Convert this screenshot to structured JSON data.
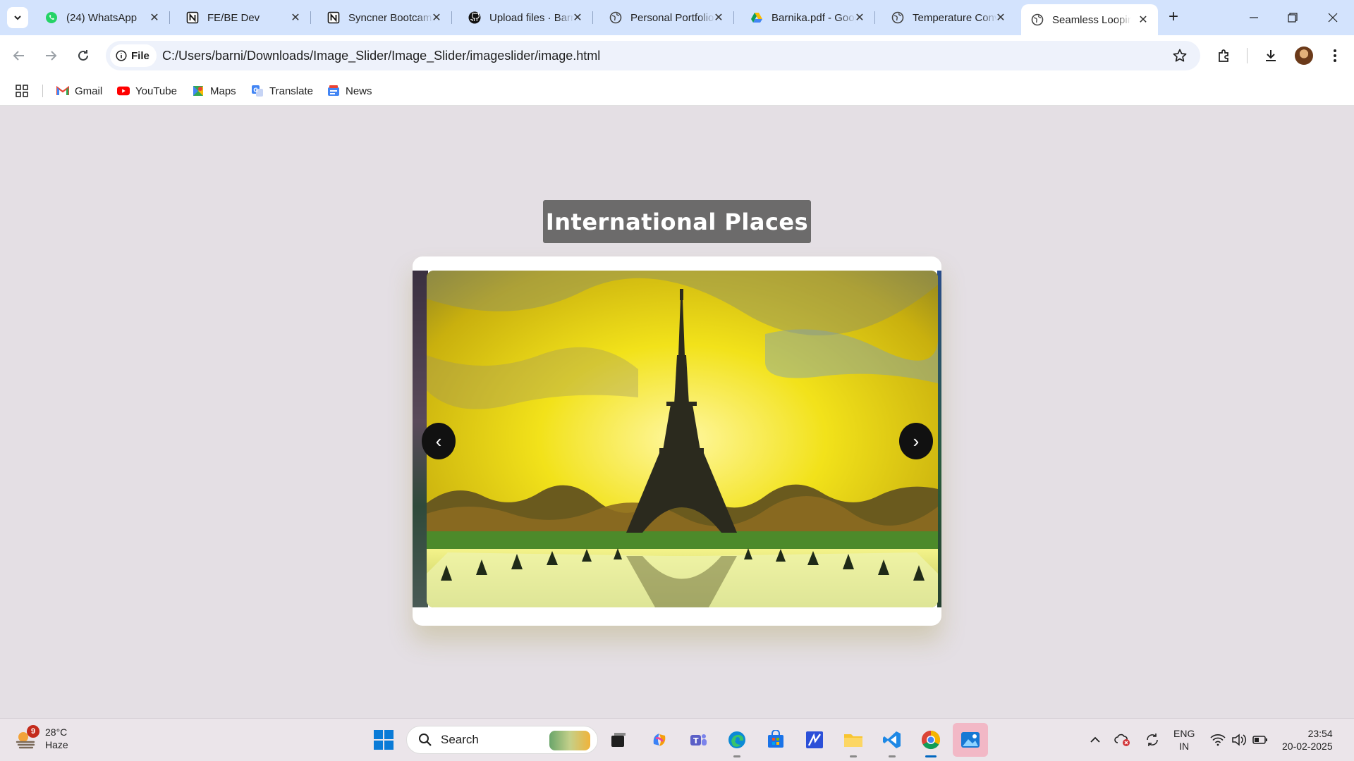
{
  "browser": {
    "tabs": [
      {
        "title": "(24) WhatsApp",
        "icon": "whatsapp-icon"
      },
      {
        "title": "FE/BE Dev",
        "icon": "notion-icon"
      },
      {
        "title": "Syncner Bootcamp",
        "icon": "notion-icon"
      },
      {
        "title": "Upload files · Barnika",
        "icon": "github-icon"
      },
      {
        "title": "Personal Portfolio",
        "icon": "globe-icon"
      },
      {
        "title": "Barnika.pdf - Google Drive",
        "icon": "google-drive-icon"
      },
      {
        "title": "Temperature Converter",
        "icon": "globe-icon"
      },
      {
        "title": "Seamless Looping",
        "icon": "globe-icon",
        "active": true
      }
    ],
    "address": {
      "chip_label": "File",
      "url": "C:/Users/barni/Downloads/Image_Slider/Image_Slider/imageslider/image.html"
    },
    "bookmarks": [
      {
        "label": "Gmail",
        "icon": "gmail-icon"
      },
      {
        "label": "YouTube",
        "icon": "youtube-icon"
      },
      {
        "label": "Maps",
        "icon": "maps-icon"
      },
      {
        "label": "Translate",
        "icon": "translate-icon"
      },
      {
        "label": "News",
        "icon": "news-icon"
      }
    ]
  },
  "page": {
    "heading": "International Places",
    "slider": {
      "current_image": "eiffel-tower-sunset",
      "prev_label": "‹",
      "next_label": "›"
    }
  },
  "taskbar": {
    "weather": {
      "badge": "9",
      "temp": "28°C",
      "condition": "Haze"
    },
    "search_placeholder": "Search",
    "lang": {
      "line1": "ENG",
      "line2": "IN"
    },
    "clock": {
      "time": "23:54",
      "date": "20-02-2025"
    }
  },
  "colors": {
    "tabstrip": "#d3e3fd",
    "page_bg": "#e4dfe4",
    "heading_bg": "#6c6b6b",
    "arrow_bg": "#111111"
  }
}
